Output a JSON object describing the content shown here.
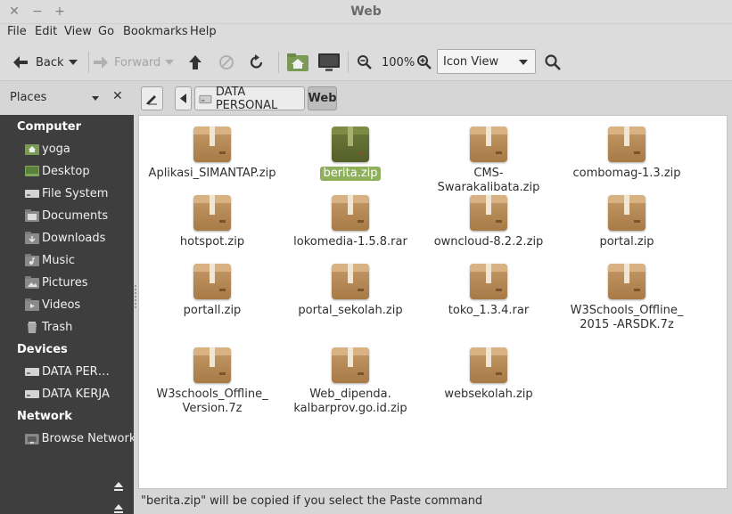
{
  "window": {
    "title": "Web"
  },
  "menu": [
    "File",
    "Edit",
    "View",
    "Go",
    "Bookmarks",
    "Help"
  ],
  "toolbar": {
    "back_label": "Back",
    "forward_label": "Forward",
    "zoom_level": "100%",
    "view_mode": "Icon View"
  },
  "location": {
    "places_label": "Places",
    "crumbs": [
      "DATA PERSONAL",
      "Web"
    ]
  },
  "sidebar": {
    "computer": {
      "heading": "Computer",
      "items": [
        "yoga",
        "Desktop",
        "File System",
        "Documents",
        "Downloads",
        "Music",
        "Pictures",
        "Videos",
        "Trash"
      ]
    },
    "devices": {
      "heading": "Devices",
      "items": [
        "DATA PER…",
        "DATA KERJA"
      ]
    },
    "network": {
      "heading": "Network",
      "items": [
        "Browse Network"
      ]
    }
  },
  "files": [
    {
      "name": "Aplikasi_SIMANTAP.zip"
    },
    {
      "name": "berita.zip",
      "selected": true
    },
    {
      "name": "CMS-Swarakalibata.zip"
    },
    {
      "name": "combomag-1.3.zip"
    },
    {
      "name": "hotspot.zip"
    },
    {
      "name": "lokomedia-1.5.8.rar"
    },
    {
      "name": "owncloud-8.2.2.zip"
    },
    {
      "name": "portal.zip"
    },
    {
      "name": "portall.zip"
    },
    {
      "name": "portal_sekolah.zip"
    },
    {
      "name": "toko_1.3.4.rar"
    },
    {
      "name": "W3Schools_Offline_\n2015 -ARSDK.7z"
    },
    {
      "name": "W3schools_Offline_\nVersion.7z"
    },
    {
      "name": "Web_dipenda.\nkalbarprov.go.id.zip"
    },
    {
      "name": "websekolah.zip"
    }
  ],
  "status": {
    "text": "\"berita.zip\" will be copied if you select the Paste command"
  }
}
